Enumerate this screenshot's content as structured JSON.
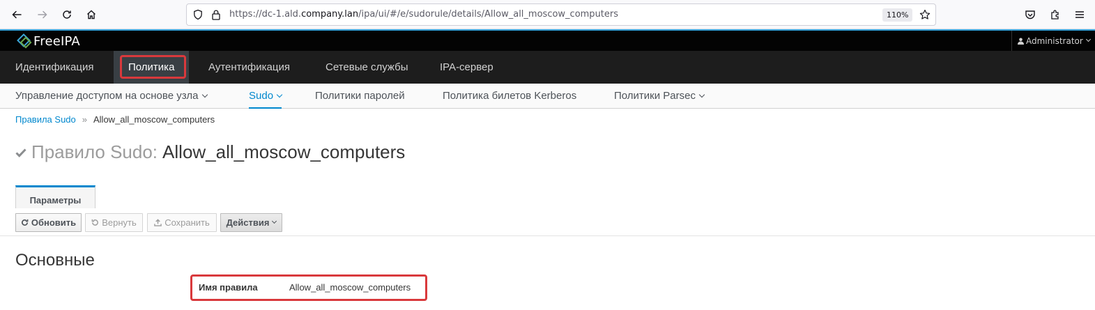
{
  "browser": {
    "url_prefix": "https://dc-1.ald.",
    "url_host": "company.lan",
    "url_path": "/ipa/ui/#/e/sudorule/details/Allow_all_moscow_computers",
    "zoom": "110%",
    "icons": [
      "back-icon",
      "forward-icon",
      "reload-icon",
      "home-icon",
      "shield-icon",
      "lock-icon",
      "star-icon",
      "pocket-icon",
      "extensions-icon",
      "menu-icon"
    ]
  },
  "app": {
    "logo_text": "FreeIPA",
    "user": "Administrator"
  },
  "menu": {
    "items": [
      "Идентификация",
      "Политика",
      "Аутентификация",
      "Сетевые службы",
      "IPA-сервер"
    ],
    "active": "Политика"
  },
  "subnav": {
    "items": [
      "Управление доступом на основе узла",
      "Sudo",
      "Политики паролей",
      "Политика билетов Kerberos",
      "Политики Parsec"
    ],
    "active": "Sudo"
  },
  "breadcrumb": {
    "parent": "Правила Sudo",
    "separator": "»",
    "current": "Allow_all_moscow_computers"
  },
  "page": {
    "title_prefix": "Правило Sudo:",
    "title_name": "Allow_all_moscow_computers",
    "tab": "Параметры"
  },
  "toolbar": {
    "refresh": "Обновить",
    "revert": "Вернуть",
    "save": "Сохранить",
    "actions": "Действия"
  },
  "section": {
    "title": "Основные",
    "field_label": "Имя правила",
    "field_value": "Allow_all_moscow_computers"
  },
  "colors": {
    "accent": "#0088ce",
    "highlight": "#d9393c",
    "header_bg": "#030303",
    "menu_bg": "#1d1d1d"
  }
}
